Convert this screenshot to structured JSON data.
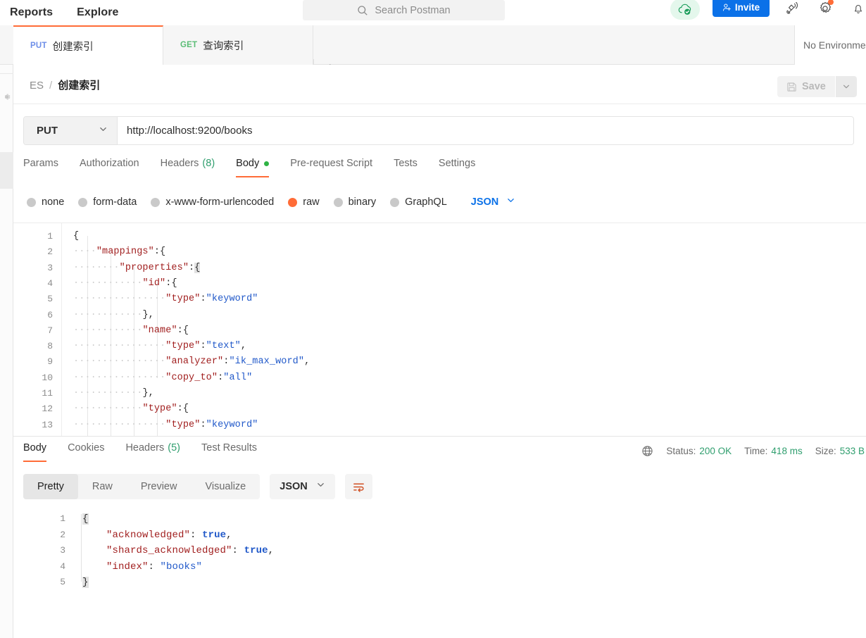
{
  "header": {
    "nav": [
      {
        "label": "Reports"
      },
      {
        "label": "Explore"
      }
    ],
    "search": {
      "placeholder": "Search Postman",
      "icon": "search-icon"
    },
    "cloud_status_icon": "cloud-sync-ok-icon",
    "invite_label": "Invite",
    "invite_icon": "person-add-icon",
    "icons": [
      {
        "name": "satellite-icon"
      },
      {
        "name": "gear-icon",
        "badge": true
      },
      {
        "name": "bell-icon"
      }
    ],
    "accent": "#ff6c37",
    "invite_color": "#0b71e8"
  },
  "tabs": {
    "items": [
      {
        "method": "PUT",
        "title": "创建索引",
        "active": true,
        "method_color": "#6d8ee8"
      },
      {
        "method": "GET",
        "title": "查询索引",
        "active": false,
        "method_color": "#5bbd76"
      }
    ],
    "new_tab_icon": "plus-icon",
    "more_icon": "ellipsis-icon",
    "environment": "No Environment"
  },
  "breadcrumb": {
    "root": "ES",
    "separator": "/",
    "leaf": "创建索引",
    "save_label": "Save",
    "save_icon": "floppy-disk-icon",
    "save_caret_icon": "chevron-down-icon",
    "save_disabled": true
  },
  "request": {
    "method": "PUT",
    "method_caret_icon": "chevron-down-icon",
    "url": "http://localhost:9200/books",
    "tabs": [
      {
        "label": "Params",
        "active": false
      },
      {
        "label": "Authorization",
        "active": false
      },
      {
        "label": "Headers",
        "count": "(8)",
        "active": false
      },
      {
        "label": "Body",
        "active": true,
        "dot": true
      },
      {
        "label": "Pre-request Script",
        "active": false
      },
      {
        "label": "Tests",
        "active": false
      },
      {
        "label": "Settings",
        "active": false
      }
    ],
    "body_types": [
      {
        "label": "none",
        "selected": false
      },
      {
        "label": "form-data",
        "selected": false
      },
      {
        "label": "x-www-form-urlencoded",
        "selected": false
      },
      {
        "label": "raw",
        "selected": true
      },
      {
        "label": "binary",
        "selected": false
      },
      {
        "label": "GraphQL",
        "selected": false
      }
    ],
    "format": "JSON",
    "format_caret_icon": "chevron-down-icon",
    "code_lines": [
      {
        "n": "1",
        "segs": [
          {
            "t": "{",
            "c": "p"
          }
        ]
      },
      {
        "n": "2",
        "segs": [
          {
            "t": "····",
            "c": "ws"
          },
          {
            "t": "\"mappings\"",
            "c": "k"
          },
          {
            "t": ":{",
            "c": "p"
          }
        ]
      },
      {
        "n": "3",
        "segs": [
          {
            "t": "····",
            "c": "ws"
          },
          {
            "t": "····",
            "c": "ws"
          },
          {
            "t": "\"properties\"",
            "c": "k"
          },
          {
            "t": ":",
            "c": "p"
          },
          {
            "t": "{",
            "c": "hl"
          }
        ]
      },
      {
        "n": "4",
        "segs": [
          {
            "t": "····",
            "c": "ws"
          },
          {
            "t": "····",
            "c": "ws"
          },
          {
            "t": "····",
            "c": "ws"
          },
          {
            "t": "\"id\"",
            "c": "k"
          },
          {
            "t": ":{",
            "c": "p"
          }
        ]
      },
      {
        "n": "5",
        "segs": [
          {
            "t": "····",
            "c": "ws"
          },
          {
            "t": "····",
            "c": "ws"
          },
          {
            "t": "····",
            "c": "ws"
          },
          {
            "t": "····",
            "c": "ws"
          },
          {
            "t": "\"type\"",
            "c": "k"
          },
          {
            "t": ":",
            "c": "p"
          },
          {
            "t": "\"keyword\"",
            "c": "s"
          }
        ]
      },
      {
        "n": "6",
        "segs": [
          {
            "t": "····",
            "c": "ws"
          },
          {
            "t": "····",
            "c": "ws"
          },
          {
            "t": "····",
            "c": "ws"
          },
          {
            "t": "},",
            "c": "p"
          }
        ]
      },
      {
        "n": "7",
        "segs": [
          {
            "t": "····",
            "c": "ws"
          },
          {
            "t": "····",
            "c": "ws"
          },
          {
            "t": "····",
            "c": "ws"
          },
          {
            "t": "\"name\"",
            "c": "k"
          },
          {
            "t": ":{",
            "c": "p"
          }
        ]
      },
      {
        "n": "8",
        "segs": [
          {
            "t": "····",
            "c": "ws"
          },
          {
            "t": "····",
            "c": "ws"
          },
          {
            "t": "····",
            "c": "ws"
          },
          {
            "t": "····",
            "c": "ws"
          },
          {
            "t": "\"type\"",
            "c": "k"
          },
          {
            "t": ":",
            "c": "p"
          },
          {
            "t": "\"text\"",
            "c": "s"
          },
          {
            "t": ",",
            "c": "p"
          }
        ]
      },
      {
        "n": "9",
        "segs": [
          {
            "t": "····",
            "c": "ws"
          },
          {
            "t": "····",
            "c": "ws"
          },
          {
            "t": "····",
            "c": "ws"
          },
          {
            "t": "····",
            "c": "ws"
          },
          {
            "t": "\"analyzer\"",
            "c": "k"
          },
          {
            "t": ":",
            "c": "p"
          },
          {
            "t": "\"ik_max_word\"",
            "c": "s"
          },
          {
            "t": ",",
            "c": "p"
          }
        ]
      },
      {
        "n": "10",
        "segs": [
          {
            "t": "····",
            "c": "ws"
          },
          {
            "t": "····",
            "c": "ws"
          },
          {
            "t": "····",
            "c": "ws"
          },
          {
            "t": "····",
            "c": "ws"
          },
          {
            "t": "\"copy_to\"",
            "c": "k"
          },
          {
            "t": ":",
            "c": "p"
          },
          {
            "t": "\"all\"",
            "c": "s"
          }
        ]
      },
      {
        "n": "11",
        "segs": [
          {
            "t": "····",
            "c": "ws"
          },
          {
            "t": "····",
            "c": "ws"
          },
          {
            "t": "····",
            "c": "ws"
          },
          {
            "t": "},",
            "c": "p"
          }
        ]
      },
      {
        "n": "12",
        "segs": [
          {
            "t": "····",
            "c": "ws"
          },
          {
            "t": "····",
            "c": "ws"
          },
          {
            "t": "····",
            "c": "ws"
          },
          {
            "t": "\"type\"",
            "c": "k"
          },
          {
            "t": ":{",
            "c": "p"
          }
        ]
      },
      {
        "n": "13",
        "segs": [
          {
            "t": "····",
            "c": "ws"
          },
          {
            "t": "····",
            "c": "ws"
          },
          {
            "t": "····",
            "c": "ws"
          },
          {
            "t": "····",
            "c": "ws"
          },
          {
            "t": "\"type\"",
            "c": "k"
          },
          {
            "t": ":",
            "c": "p"
          },
          {
            "t": "\"keyword\"",
            "c": "s"
          }
        ]
      }
    ]
  },
  "response": {
    "tabs": [
      {
        "label": "Body",
        "active": true
      },
      {
        "label": "Cookies",
        "active": false
      },
      {
        "label": "Headers",
        "count": "(5)",
        "active": false
      },
      {
        "label": "Test Results",
        "active": false
      }
    ],
    "globe_icon": "globe-icon",
    "meta": [
      {
        "label": "Status:",
        "value": "200 OK"
      },
      {
        "label": "Time:",
        "value": "418 ms"
      },
      {
        "label": "Size:",
        "value": "533 B"
      }
    ],
    "view_modes": [
      {
        "label": "Pretty",
        "active": true
      },
      {
        "label": "Raw",
        "active": false
      },
      {
        "label": "Preview",
        "active": false
      },
      {
        "label": "Visualize",
        "active": false
      }
    ],
    "format": "JSON",
    "format_caret_icon": "chevron-down-icon",
    "wrap_icon": "word-wrap-icon",
    "code_lines": [
      {
        "n": "1",
        "segs": [
          {
            "t": "{",
            "c": "hl"
          }
        ]
      },
      {
        "n": "2",
        "segs": [
          {
            "t": "    ",
            "c": "p"
          },
          {
            "t": "\"acknowledged\"",
            "c": "k"
          },
          {
            "t": ": ",
            "c": "p"
          },
          {
            "t": "true",
            "c": "b"
          },
          {
            "t": ",",
            "c": "p"
          }
        ]
      },
      {
        "n": "3",
        "segs": [
          {
            "t": "    ",
            "c": "p"
          },
          {
            "t": "\"shards_acknowledged\"",
            "c": "k"
          },
          {
            "t": ": ",
            "c": "p"
          },
          {
            "t": "true",
            "c": "b"
          },
          {
            "t": ",",
            "c": "p"
          }
        ]
      },
      {
        "n": "4",
        "segs": [
          {
            "t": "    ",
            "c": "p"
          },
          {
            "t": "\"index\"",
            "c": "k"
          },
          {
            "t": ": ",
            "c": "p"
          },
          {
            "t": "\"books\"",
            "c": "s"
          }
        ]
      },
      {
        "n": "5",
        "segs": [
          {
            "t": "}",
            "c": "hl"
          }
        ]
      }
    ]
  }
}
